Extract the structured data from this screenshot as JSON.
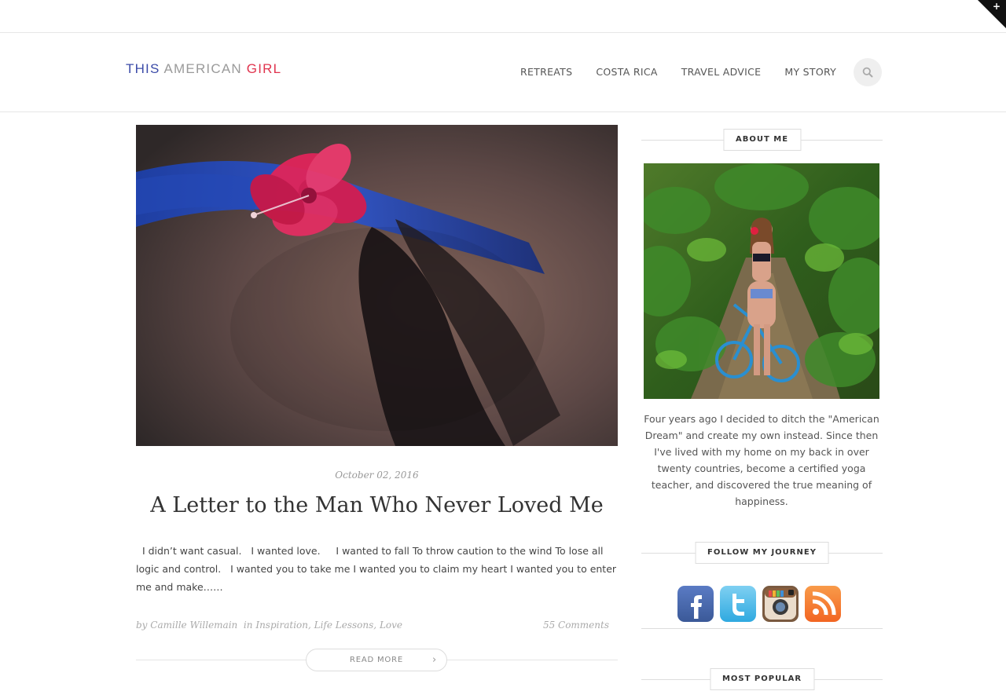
{
  "site": {
    "logo": {
      "part1": "THIS ",
      "part2": "AMERICAN ",
      "part3": "GIRL"
    }
  },
  "nav": {
    "items": [
      "RETREATS",
      "COSTA RICA",
      "TRAVEL ADVICE",
      "MY STORY"
    ]
  },
  "post": {
    "date": "October 02, 2016",
    "title": "A Letter to the Man Who Never Loved Me",
    "excerpt": "  I didn’t want casual.   I wanted love.     I wanted to fall To throw caution to the wind To lose all logic and control.   I wanted you to take me I wanted you to claim my heart I wanted you to enter me and make……",
    "meta": {
      "by": "by",
      "author": "Camille Willemain",
      "in": "in",
      "categories": [
        "Inspiration",
        "Life Lessons",
        "Love"
      ],
      "comments": "55 Comments"
    },
    "read_more": "READ MORE"
  },
  "sidebar": {
    "about": {
      "heading": "ABOUT ME",
      "text": "Four years ago I decided to ditch the \"American Dream\" and create my own instead. Since then I've lived with my home on my back in over twenty countries, become a certified yoga teacher, and discovered the true meaning of happiness."
    },
    "follow": {
      "heading": "FOLLOW MY JOURNEY",
      "icons": [
        "facebook-icon",
        "twitter-icon",
        "instagram-icon",
        "rss-icon"
      ]
    },
    "popular": {
      "heading": "MOST POPULAR"
    }
  },
  "colors": {
    "logo_blue": "#3b4ba8",
    "logo_gray": "#9a9a9a",
    "logo_red": "#e0344e",
    "facebook": "#3b5998",
    "twitter": "#2fa9e0",
    "rss": "#f26522"
  }
}
